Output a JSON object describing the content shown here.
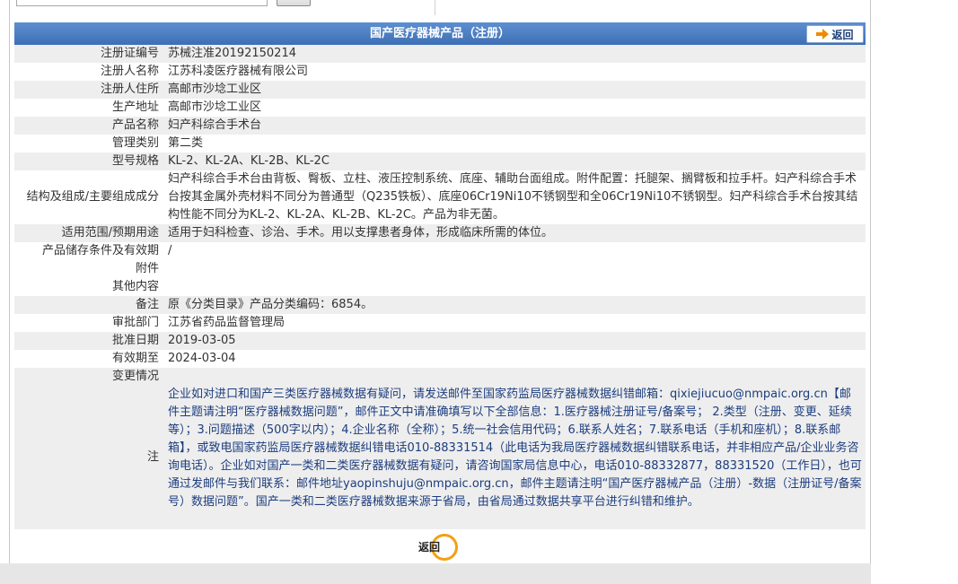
{
  "header": {
    "title": "国产医疗器械产品（注册）",
    "back_label": "返回"
  },
  "rows": [
    {
      "label": "注册证编号",
      "value": "苏械注准20192150214"
    },
    {
      "label": "注册人名称",
      "value": "江苏科凌医疗器械有限公司"
    },
    {
      "label": "注册人住所",
      "value": "高邮市沙埝工业区"
    },
    {
      "label": "生产地址",
      "value": "高邮市沙埝工业区"
    },
    {
      "label": "产品名称",
      "value": "妇产科综合手术台"
    },
    {
      "label": "管理类别",
      "value": "第二类"
    },
    {
      "label": "型号规格",
      "value": "KL-2、KL-2A、KL-2B、KL-2C"
    },
    {
      "label": "结构及组成/主要组成成分",
      "value": "妇产科综合手术台由背板、臀板、立柱、液压控制系统、底座、辅助台面组成。附件配置：托腿架、搁臂板和拉手杆。妇产科综合手术台按其金属外壳材料不同分为普通型（Q235铁板）、底座06Cr19Ni10不锈钢型和全06Cr19Ni10不锈钢型。妇产科综合手术台按其结构性能不同分为KL-2、KL-2A、KL-2B、KL-2C。产品为非无菌。"
    },
    {
      "label": "适用范围/预期用途",
      "value": "适用于妇科检查、诊治、手术。用以支撑患者身体，形成临床所需的体位。"
    },
    {
      "label": "产品储存条件及有效期",
      "value": "/"
    },
    {
      "label": "附件",
      "value": ""
    },
    {
      "label": "其他内容",
      "value": ""
    },
    {
      "label": "备注",
      "value": "原《分类目录》产品分类编码：6854。"
    },
    {
      "label": "审批部门",
      "value": "江苏省药品监督管理局"
    },
    {
      "label": "批准日期",
      "value": "2019-03-05"
    },
    {
      "label": "有效期至",
      "value": "2024-03-04"
    },
    {
      "label": "变更情况",
      "value": ""
    }
  ],
  "note": {
    "label": "注",
    "value": "企业如对进口和国产三类医疗器械数据有疑问，请发送邮件至国家药监局医疗器械数据纠错邮箱：qixiejiucuo@nmpaic.org.cn【邮件主题请注明“医疗器械数据问题”，邮件正文中请准确填写以下全部信息：1.医疗器械注册证号/备案号； 2.类型（注册、变更、延续等）；3.问题描述（500字以内）；4.企业名称（全称）；5.统一社会信用代码；6.联系人姓名；7.联系电话（手机和座机）；8.联系邮箱】，或致电国家药监局医疗器械数据纠错电话010-88331514（此电话为我局医疗器械数据纠错联系电话，并非相应产品/企业业务咨询电话）。企业如对国产一类和二类医疗器械数据有疑问，请咨询国家局信息中心，电话010-88332877，88331520（工作日），也可通过发邮件与我们联系：邮件地址yaopinshuju@nmpaic.org.cn，邮件主题请注明“国产医疗器械产品（注册）-数据（注册证号/备案号）数据问题”。国产一类和二类医疗器械数据来源于省局，由省局通过数据共享平台进行纠错和维护。"
  },
  "footer": {
    "back_label": "返回"
  },
  "colors": {
    "header_bg": "#4a7cc0",
    "row_alt": "#eeeeee",
    "note_text": "#1c3d7e",
    "back_ring": "#f3a012"
  }
}
